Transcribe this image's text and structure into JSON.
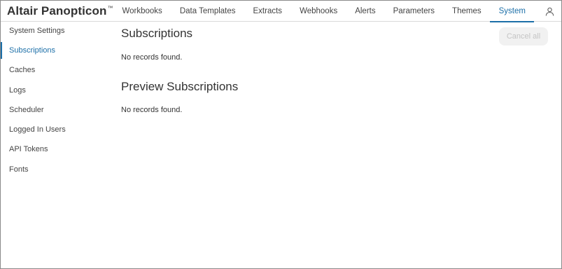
{
  "app": {
    "logo_text": "Altair Panopticon",
    "logo_mark": "™"
  },
  "nav": {
    "tabs": [
      {
        "label": "Workbooks",
        "active": false
      },
      {
        "label": "Data Templates",
        "active": false
      },
      {
        "label": "Extracts",
        "active": false
      },
      {
        "label": "Webhooks",
        "active": false
      },
      {
        "label": "Alerts",
        "active": false
      },
      {
        "label": "Parameters",
        "active": false
      },
      {
        "label": "Themes",
        "active": false
      },
      {
        "label": "System",
        "active": true
      }
    ],
    "user_icon": "user-icon"
  },
  "sidebar": {
    "items": [
      {
        "label": "System Settings",
        "active": false
      },
      {
        "label": "Subscriptions",
        "active": true
      },
      {
        "label": "Caches",
        "active": false
      },
      {
        "label": "Logs",
        "active": false
      },
      {
        "label": "Scheduler",
        "active": false
      },
      {
        "label": "Logged In Users",
        "active": false
      },
      {
        "label": "API Tokens",
        "active": false
      },
      {
        "label": "Fonts",
        "active": false
      }
    ]
  },
  "main": {
    "subscriptions_title": "Subscriptions",
    "subscriptions_empty": "No records found.",
    "preview_title": "Preview Subscriptions",
    "preview_empty": "No records found.",
    "cancel_all_label": "Cancel all",
    "cancel_all_disabled": true
  },
  "colors": {
    "accent": "#1c6fa8",
    "text": "#333333",
    "disabled_text": "#c4c4c4",
    "disabled_bg": "#f1f1f1"
  }
}
